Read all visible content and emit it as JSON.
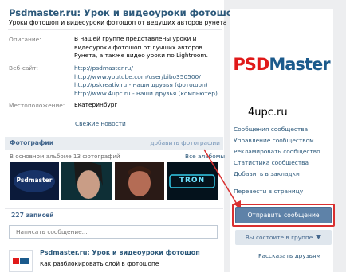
{
  "group": {
    "title": "Psdmaster.ru: Урок и видеоуроки фотошоп",
    "status": "Уроки фотошоп и видеоуроки фотошоп от ведущих авторов рунета"
  },
  "info": {
    "description_label": "Описание:",
    "description_value": "В нашей группе представлены уроки и видеоуроки фотошоп от лучших авторов Рунета, а также видео уроки по Lightroom.",
    "website_label": "Веб-сайт:",
    "websites": [
      "http://psdmaster.ru/",
      "http://www.youtube.com/user/bibo350500/",
      "http://pskreativ.ru - наши друзья (фотошоп)",
      "http://www.4upc.ru - наши друзья (компьютер)"
    ],
    "location_label": "Местоположение:",
    "location_value": "Екатеринбург",
    "more_news": "Свежие новости"
  },
  "photos": {
    "title": "Фотографии",
    "add": "добавить фотографии",
    "album_text": "В основном альбоме 13 фотографий",
    "all_albums": "Все альбомы",
    "thumb1_text": "Psdmaster",
    "thumb5_text": "TRON"
  },
  "posts": {
    "count": "227 записей",
    "compose_placeholder": "Написать сообщение...",
    "author": "Psdmaster.ru: Урок и видеоуроки фотошоп",
    "text": "Как разблокировать слой в фотошопе"
  },
  "logo": {
    "part1": "PSD",
    "part2": "Master"
  },
  "watermark": "4upc.ru",
  "menu": {
    "items": [
      "Сообщения сообщества",
      "Управление сообществом",
      "Рекламировать сообщество",
      "Статистика сообщества",
      "Добавить в закладки",
      "Перевести в страницу"
    ],
    "send_message": "Отправить сообщение",
    "member_status": "Вы состоите в группе",
    "tell_friends": "Рассказать друзьям"
  },
  "colors": {
    "accent_link": "#2b587a",
    "highlight": "#d93030",
    "button": "#5e82a8"
  }
}
